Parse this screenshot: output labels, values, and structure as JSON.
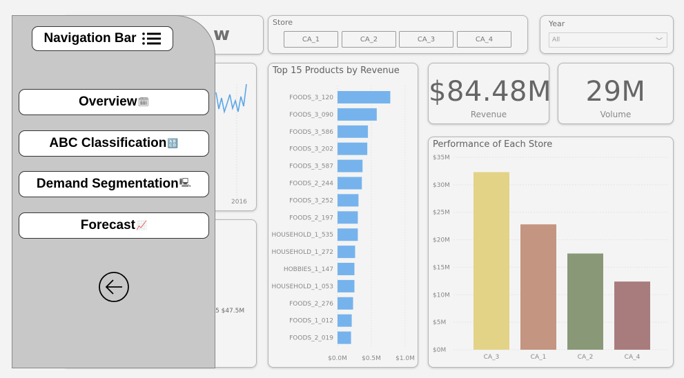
{
  "page_title_fragment": "w",
  "store_slicer": {
    "title": "Store",
    "options": [
      "CA_1",
      "CA_2",
      "CA_3",
      "CA_4"
    ]
  },
  "year_slicer": {
    "title": "Year",
    "selected": "All"
  },
  "kpis": {
    "revenue_value": "$84.48M",
    "revenue_label": "Revenue",
    "volume_value": "29M",
    "volume_label": "Volume"
  },
  "left_chart": {
    "x_tick": "2016",
    "partial_label": "5 $47.5M"
  },
  "nav": {
    "title": "Navigation Bar",
    "items": [
      {
        "label": "Overview",
        "icon": "🗓"
      },
      {
        "label": "ABC Classification",
        "icon": "🔠"
      },
      {
        "label": "Demand Segmentation",
        "icon": "🖳"
      },
      {
        "label": "Forecast",
        "icon": "📈"
      }
    ],
    "back_icon": "arrow-left-circle"
  },
  "colors": {
    "product_bar": "#76b3ec",
    "line": "#5aa6e6",
    "CA_3": "#e3d387",
    "CA_1": "#c49580",
    "CA_2": "#899978",
    "CA_4": "#a87c7d"
  },
  "chart_data": [
    {
      "type": "bar",
      "orientation": "horizontal",
      "title": "Top 15 Products by Revenue",
      "categories": [
        "FOODS_3_120",
        "FOODS_3_090",
        "FOODS_3_586",
        "FOODS_3_202",
        "FOODS_3_587",
        "FOODS_2_244",
        "FOODS_3_252",
        "FOODS_2_197",
        "HOUSEHOLD_1_535",
        "HOUSEHOLD_1_272",
        "HOBBIES_1_147",
        "HOUSEHOLD_1_053",
        "FOODS_2_276",
        "FOODS_1_012",
        "FOODS_2_019"
      ],
      "values": [
        0.78,
        0.58,
        0.45,
        0.44,
        0.37,
        0.36,
        0.31,
        0.3,
        0.3,
        0.26,
        0.25,
        0.25,
        0.23,
        0.21,
        0.2
      ],
      "xlim": [
        0,
        1.0
      ],
      "xticks": [
        "$0.0M",
        "$0.5M",
        "$1.0M"
      ],
      "grid": true
    },
    {
      "type": "bar",
      "title": "Performance of Each Store",
      "categories": [
        "CA_3",
        "CA_1",
        "CA_2",
        "CA_4"
      ],
      "values": [
        32.3,
        22.8,
        17.5,
        12.4
      ],
      "ylim": [
        0,
        35
      ],
      "yticks": [
        "$0M",
        "$5M",
        "$10M",
        "$15M",
        "$20M",
        "$25M",
        "$30M",
        "$35M"
      ],
      "grid": true
    }
  ]
}
